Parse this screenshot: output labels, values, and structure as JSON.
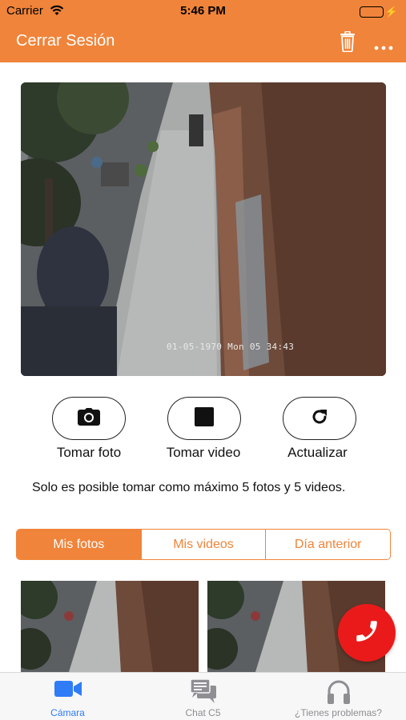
{
  "status_bar": {
    "carrier": "Carrier",
    "time": "5:46 PM",
    "battery_level": 1.0
  },
  "nav": {
    "title": "Cerrar Sesión",
    "icons": [
      "trash-icon",
      "more-icon"
    ]
  },
  "camera": {
    "timestamp": "01-05-1970 Mon 05 34:43"
  },
  "actions": [
    {
      "label": "Tomar foto",
      "icon": "camera-icon"
    },
    {
      "label": "Tomar video",
      "icon": "stop-icon"
    },
    {
      "label": "Actualizar",
      "icon": "refresh-icon"
    }
  ],
  "info_text": "Solo es posible tomar como máximo 5 fotos y 5 videos.",
  "tabs_segment": [
    {
      "label": "Mis fotos",
      "active": true
    },
    {
      "label": "Mis videos",
      "active": false
    },
    {
      "label": "Día anterior",
      "active": false
    }
  ],
  "tab_bar": [
    {
      "label": "Cámara",
      "icon": "video-camera-icon",
      "active": true
    },
    {
      "label": "Chat C5",
      "icon": "chat-icon",
      "active": false
    },
    {
      "label": "¿Tienes problemas?",
      "icon": "headphones-icon",
      "active": false
    }
  ],
  "colors": {
    "accent": "#f0843a",
    "call": "#ea1a1a",
    "tab_active": "#2f7cf6"
  }
}
